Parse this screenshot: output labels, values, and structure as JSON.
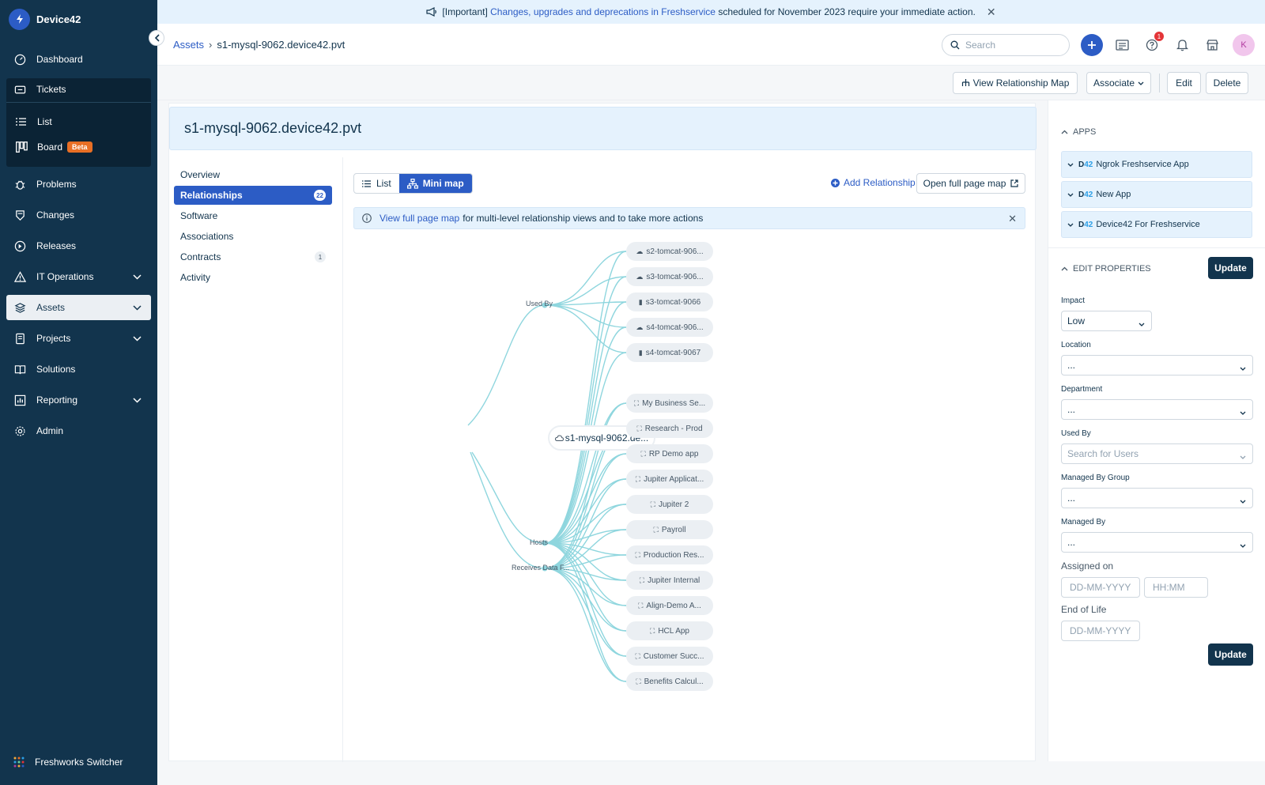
{
  "app": {
    "name": "Device42"
  },
  "sidebar": {
    "items": [
      {
        "label": "Dashboard",
        "icon": "dashboard-icon"
      },
      {
        "label": "Tickets",
        "icon": "ticket-icon"
      },
      {
        "label": "List",
        "icon": "list-icon"
      },
      {
        "label": "Board",
        "icon": "board-icon",
        "badge": "Beta"
      },
      {
        "label": "Problems",
        "icon": "bug-icon"
      },
      {
        "label": "Changes",
        "icon": "changes-icon"
      },
      {
        "label": "Releases",
        "icon": "release-icon"
      },
      {
        "label": "IT Operations",
        "icon": "alert-icon"
      },
      {
        "label": "Assets",
        "icon": "assets-icon"
      },
      {
        "label": "Projects",
        "icon": "projects-icon"
      },
      {
        "label": "Solutions",
        "icon": "book-icon"
      },
      {
        "label": "Reporting",
        "icon": "reporting-icon"
      },
      {
        "label": "Admin",
        "icon": "gear-icon"
      }
    ],
    "switcher": "Freshworks Switcher"
  },
  "banner": {
    "prefix": "[Important]",
    "link": "Changes, upgrades and deprecations in Freshservice",
    "middle": "scheduled for November 2023",
    "bold": "require your immediate action."
  },
  "header": {
    "breadcrumb_root": "Assets",
    "breadcrumb_current": "s1-mysql-9062.device42.pvt",
    "search_placeholder": "Search",
    "help_badge": "1",
    "avatar": "K"
  },
  "toolbar": {
    "view_map": "View Relationship Map",
    "associate": "Associate",
    "edit": "Edit",
    "delete": "Delete"
  },
  "asset": {
    "title": "s1-mysql-9062.device42.pvt"
  },
  "left_nav": [
    {
      "label": "Overview",
      "count": ""
    },
    {
      "label": "Relationships",
      "count": "22"
    },
    {
      "label": "Software",
      "count": ""
    },
    {
      "label": "Associations",
      "count": ""
    },
    {
      "label": "Contracts",
      "count": "1"
    },
    {
      "label": "Activity",
      "count": ""
    }
  ],
  "view_toggle": {
    "list": "List",
    "minimap": "Mini map"
  },
  "add_relationship": "Add Relationship",
  "open_full_map": "Open full page map",
  "info": {
    "link": "View full page map",
    "text": "for multi-level relationship views and to take more actions"
  },
  "map": {
    "root": "s1-mysql-9062.de...",
    "edge_labels": {
      "used_by": "Used By",
      "hosts": "Hosts",
      "receives": "Receives Data F..."
    },
    "nodes": [
      {
        "label": "s2-tomcat-906...",
        "icon": "cloud-icon"
      },
      {
        "label": "s3-tomcat-906...",
        "icon": "cloud-icon"
      },
      {
        "label": "s3-tomcat-9066",
        "icon": "server-icon"
      },
      {
        "label": "s4-tomcat-906...",
        "icon": "cloud-icon"
      },
      {
        "label": "s4-tomcat-9067",
        "icon": "server-icon"
      },
      {
        "label": "My Business Se...",
        "icon": "app-icon"
      },
      {
        "label": "Research - Prod",
        "icon": "app-icon"
      },
      {
        "label": "RP Demo app",
        "icon": "app-icon"
      },
      {
        "label": "Jupiter Applicat...",
        "icon": "app-icon"
      },
      {
        "label": "Jupiter 2",
        "icon": "app-icon"
      },
      {
        "label": "Payroll",
        "icon": "app-icon"
      },
      {
        "label": "Production Res...",
        "icon": "app-icon"
      },
      {
        "label": "Jupiter Internal",
        "icon": "app-icon"
      },
      {
        "label": "Align-Demo A...",
        "icon": "app-icon"
      },
      {
        "label": "HCL App",
        "icon": "app-icon"
      },
      {
        "label": "Customer Succ...",
        "icon": "app-icon"
      },
      {
        "label": "Benefits Calcul...",
        "icon": "app-icon"
      }
    ]
  },
  "apps_panel": {
    "title": "APPS",
    "apps": [
      "Ngrok Freshservice App",
      "New App",
      "Device42 For Freshservice"
    ],
    "d42_prefix": "D",
    "d42_suffix": "42"
  },
  "properties": {
    "title": "EDIT PROPERTIES",
    "update": "Update",
    "impact_label": "Impact",
    "impact_value": "Low",
    "location_label": "Location",
    "location_value": "...",
    "department_label": "Department",
    "department_value": "...",
    "used_by_label": "Used By",
    "used_by_placeholder": "Search for Users",
    "managed_group_label": "Managed By Group",
    "managed_group_value": "...",
    "managed_by_label": "Managed By",
    "managed_by_value": "...",
    "assigned_on_label": "Assigned on",
    "date_placeholder": "DD-MM-YYYY",
    "time_placeholder": "HH:MM",
    "eol_label": "End of Life",
    "eol_placeholder": "DD-MM-YYYY"
  },
  "colors": {
    "sidebar": "#12344d",
    "accent": "#2c5cc5",
    "edge": "#8fd6de",
    "beta": "#e86f25"
  }
}
